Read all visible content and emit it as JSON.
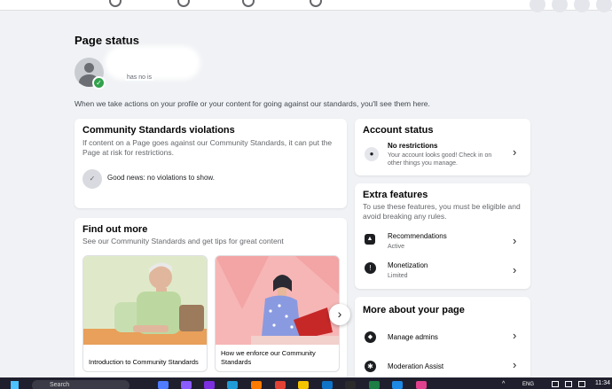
{
  "page": {
    "title": "Page status",
    "name_partial": "has no is",
    "notice": "When we take actions on your profile or your content for going against our standards, you'll see them here."
  },
  "violations": {
    "title": "Community Standards violations",
    "description": "If content on a Page goes against our Community Standards, it can put the Page at risk for restrictions.",
    "status": "Good news: no violations to show."
  },
  "find_out": {
    "title": "Find out more",
    "subtitle": "See our Community Standards and get tips for great content",
    "cards": [
      {
        "caption": "Introduction to Community Standards"
      },
      {
        "caption": "How we enforce our Community Standards"
      }
    ]
  },
  "account_status": {
    "title": "Account status",
    "item_title": "No restrictions",
    "item_sub": "Your account looks good! Check in on other things you manage."
  },
  "extra_features": {
    "title": "Extra features",
    "description": "To use these features, you must be eligible and avoid breaking any rules.",
    "items": [
      {
        "label": "Recommendations",
        "status": "Active",
        "icon": "recommendations-icon"
      },
      {
        "label": "Monetization",
        "status": "Limited",
        "icon": "alert-icon"
      }
    ]
  },
  "more_page": {
    "title": "More about your page",
    "items": [
      {
        "label": "Manage admins",
        "icon": "shield-icon"
      },
      {
        "label": "Moderation Assist",
        "icon": "gear-icon"
      }
    ]
  },
  "taskbar": {
    "search": "Search",
    "lang": "ENG",
    "time": "11:34"
  },
  "colors": {
    "background": "#f0f2f5",
    "check_green": "#31a24c"
  }
}
